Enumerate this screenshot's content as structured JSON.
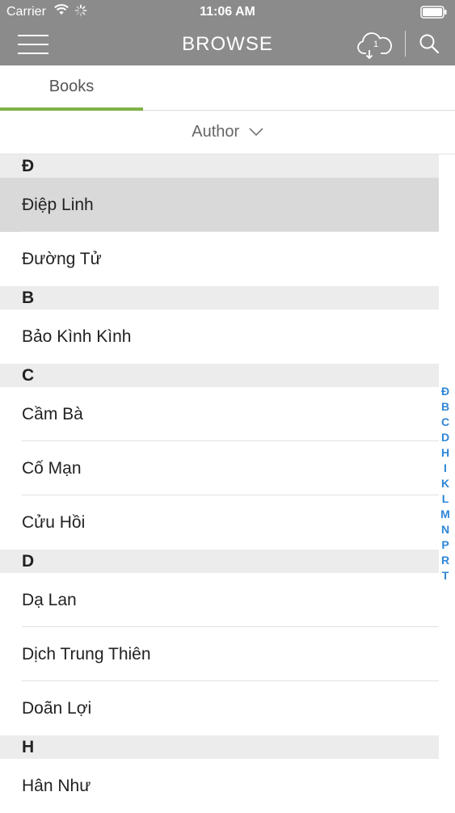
{
  "status": {
    "carrier": "Carrier",
    "time": "11:06 AM"
  },
  "nav": {
    "title": "BROWSE",
    "cloud_badge": "1"
  },
  "tabs": [
    {
      "label": "Books",
      "active": true
    }
  ],
  "sort": {
    "label": "Author"
  },
  "sections": [
    {
      "letter": "Đ",
      "rows": [
        "Điệp Linh",
        "Đường Tử"
      ]
    },
    {
      "letter": "B",
      "rows": [
        "Bảo Kình Kình"
      ]
    },
    {
      "letter": "C",
      "rows": [
        "Cầm Bà",
        "Cố Mạn",
        "Cửu Hồi"
      ]
    },
    {
      "letter": "D",
      "rows": [
        "Dạ Lan",
        "Dịch Trung Thiên",
        "Doãn Lợi"
      ]
    },
    {
      "letter": "H",
      "rows": [
        "Hân Như"
      ]
    }
  ],
  "index_letters": [
    "Đ",
    "B",
    "C",
    "D",
    "H",
    "I",
    "K",
    "L",
    "M",
    "N",
    "P",
    "R",
    "T"
  ],
  "colors": {
    "topbar": "#8b8b8b",
    "tab_accent": "#7fb246",
    "index_link": "#2f86d6",
    "selected_row": "#d9d9d9"
  }
}
